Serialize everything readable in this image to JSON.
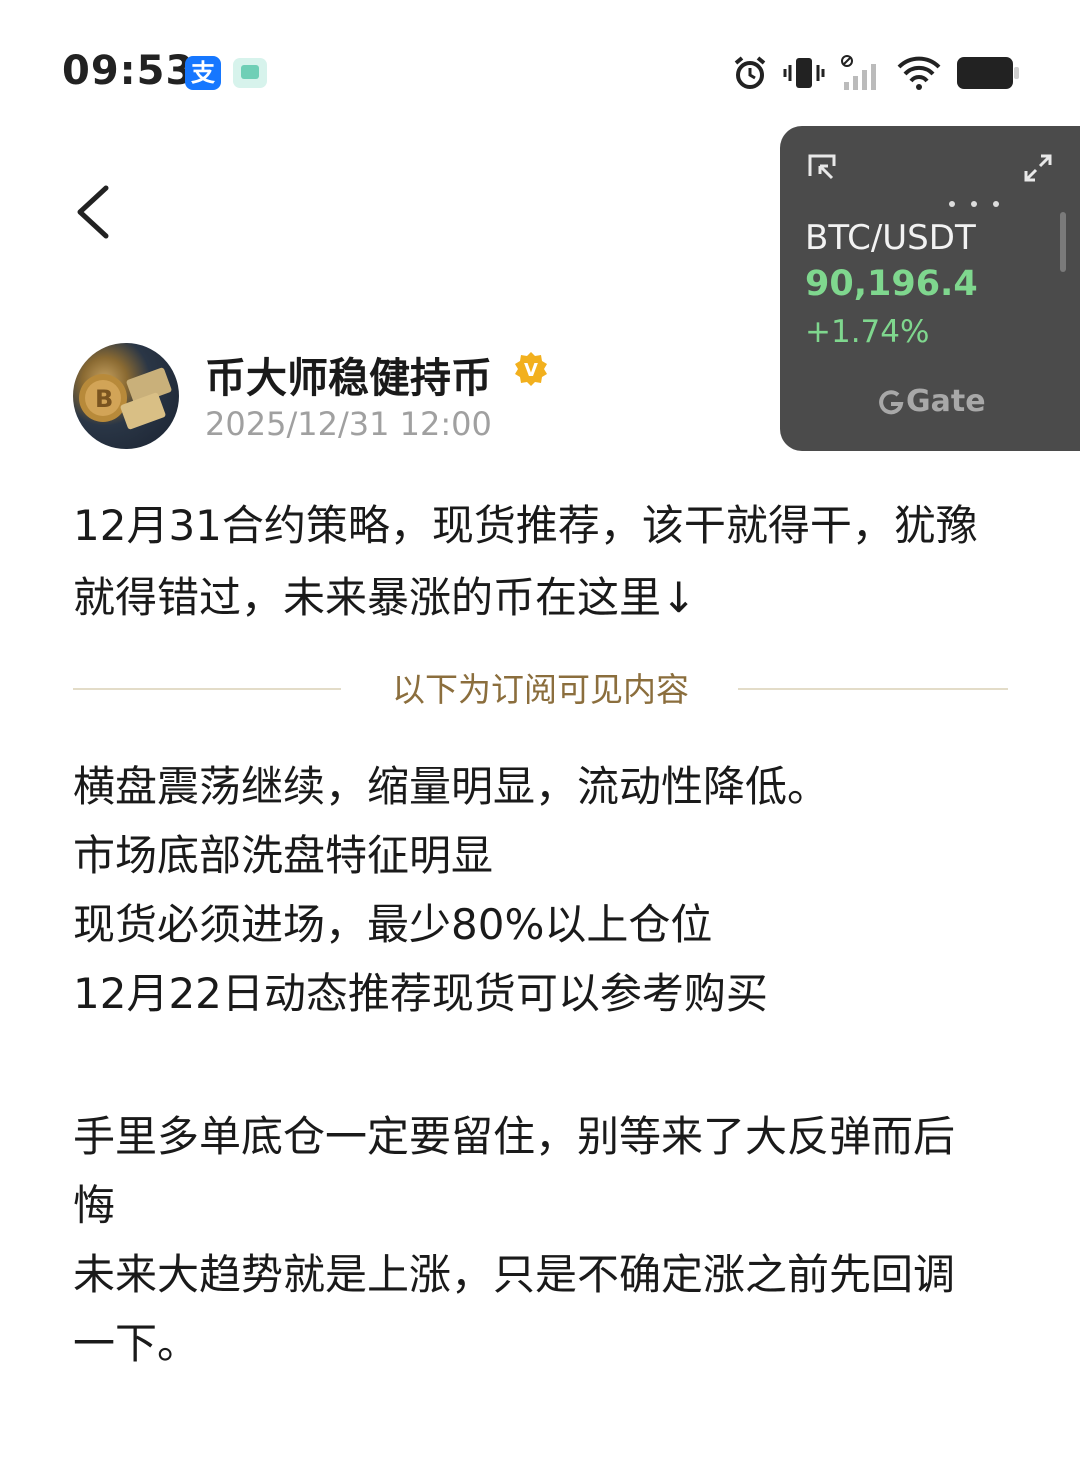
{
  "status_bar": {
    "time": "09:53",
    "alipay_glyph": "支",
    "icons": [
      "alarm-icon",
      "vibrate-icon",
      "no-sim-signal-icon",
      "wifi-icon",
      "battery-icon"
    ]
  },
  "widget": {
    "pair": "BTC/USDT",
    "price": "90,196.4",
    "change": "+1.74%",
    "brand": "Gate",
    "price_color": "#7fd78e"
  },
  "author": {
    "name": "币大师稳健持币",
    "badge": "V",
    "date": "2025/12/31 12:00"
  },
  "post": {
    "intro": "12月31合约策略，现货推荐，该干就得干，犹豫就得错过，未来暴涨的币在这里↓",
    "divider": "以下为订阅可见内容",
    "lines1": [
      "横盘震荡继续，缩量明显，流动性降低。",
      "市场底部洗盘特征明显",
      "现货必须进场，最少80%以上仓位",
      "12月22日动态推荐现货可以参考购买"
    ],
    "lines2": [
      "手里多单底仓一定要留住，别等来了大反弹而后悔",
      "未来大趋势就是上涨，只是不确定涨之前先回调一下。"
    ]
  }
}
